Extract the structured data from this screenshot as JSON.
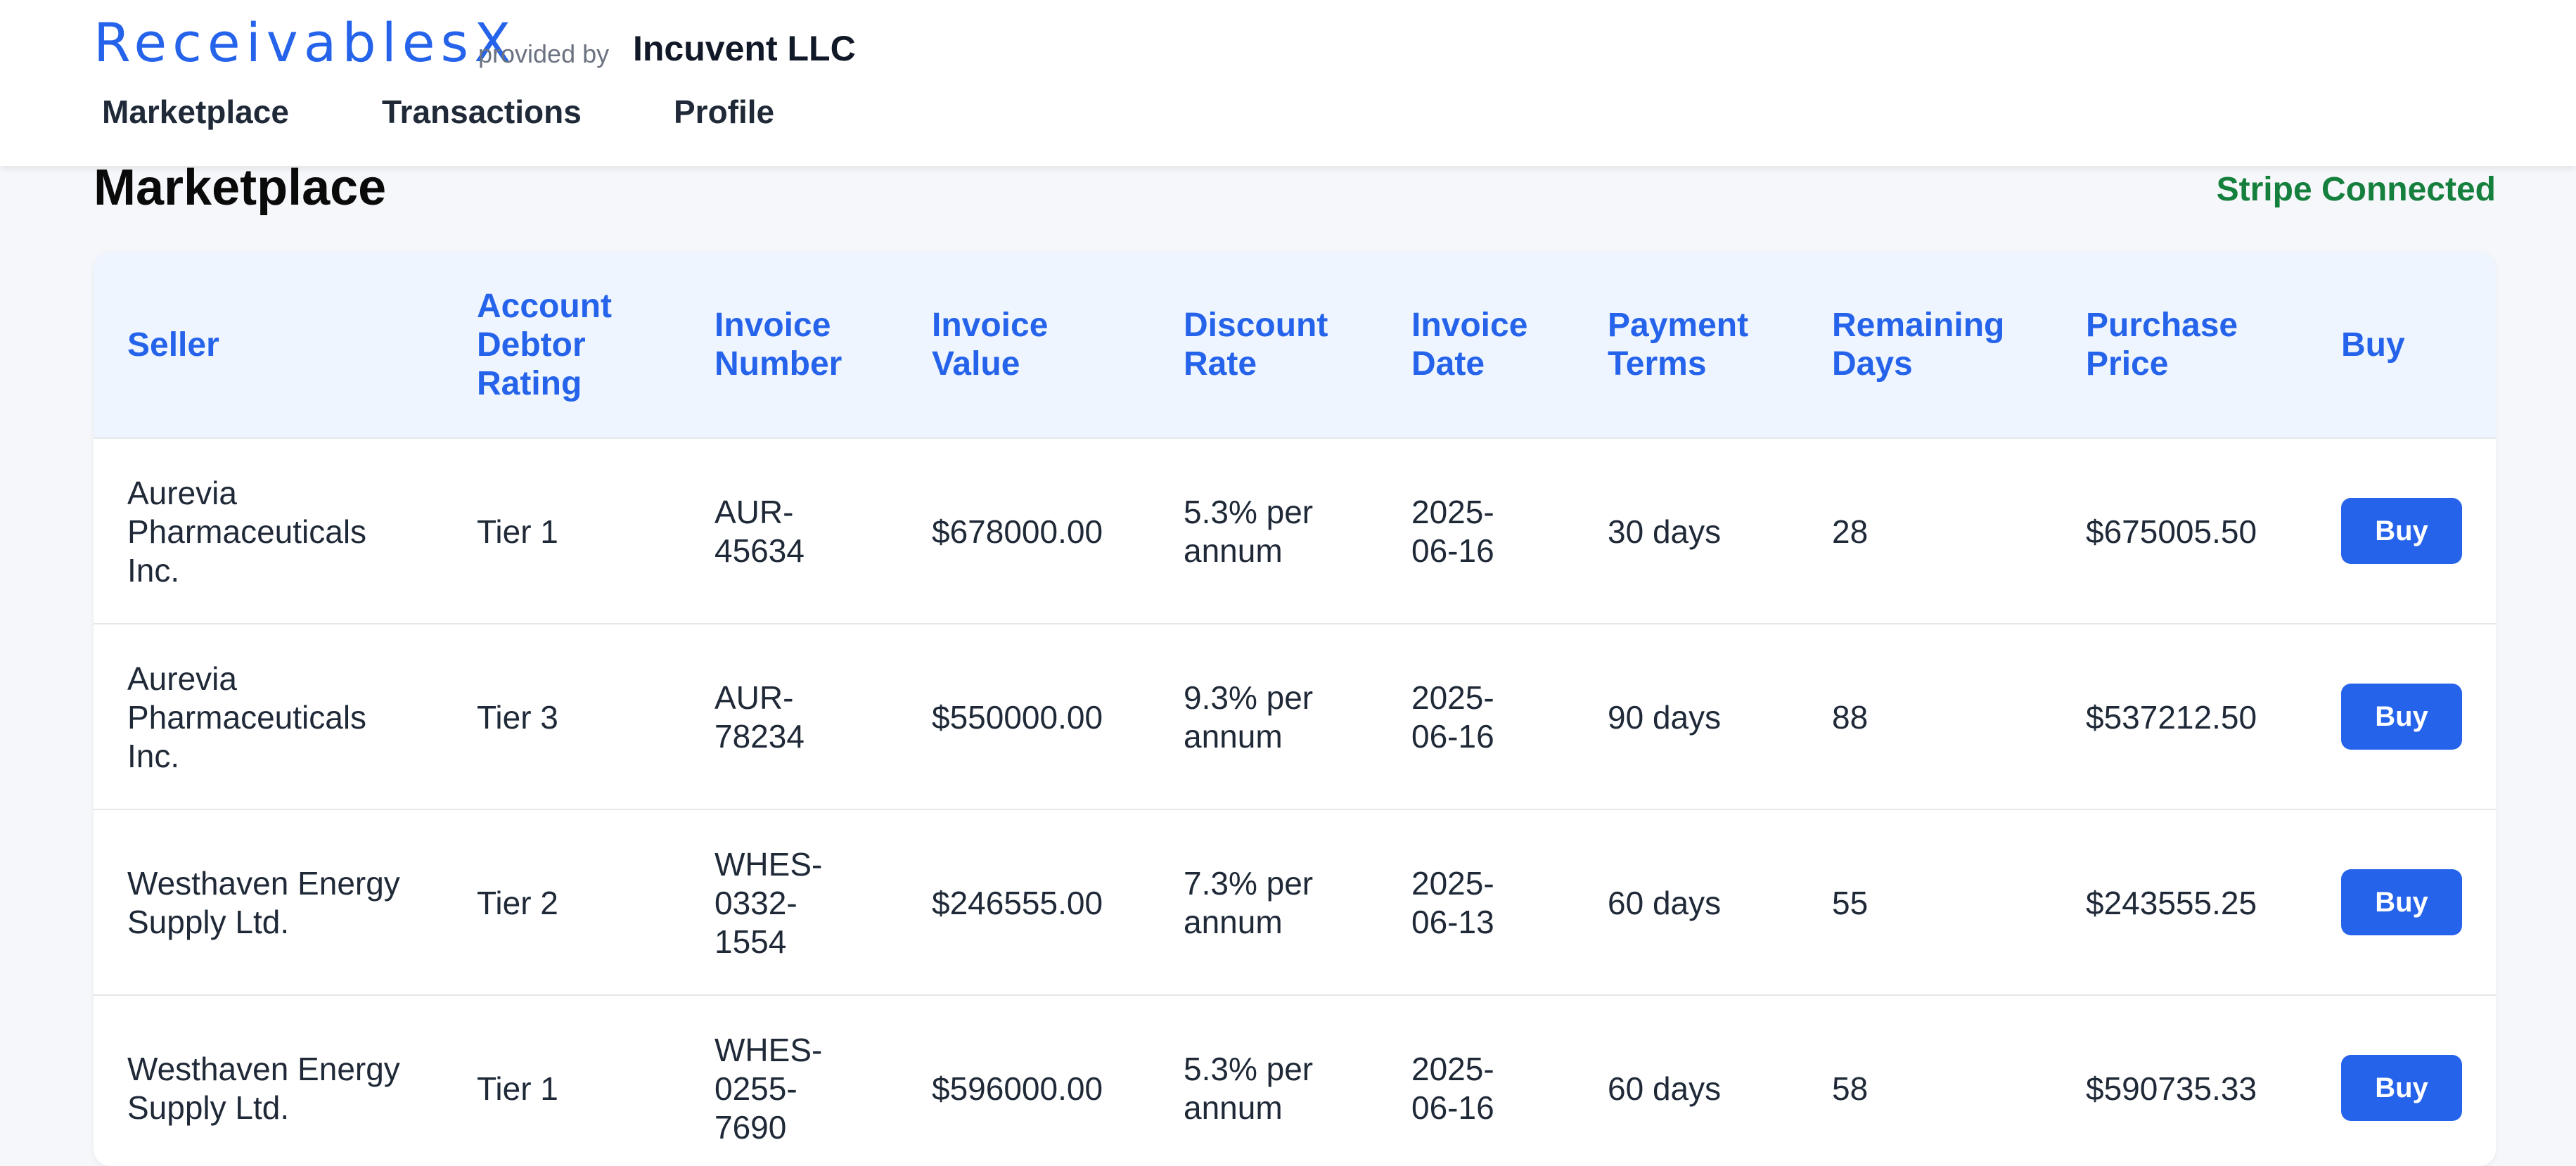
{
  "header": {
    "brand": "ReceivablesX",
    "provided_by": "provided by",
    "company": "Incuvent LLC",
    "nav": [
      "Marketplace",
      "Transactions",
      "Profile"
    ]
  },
  "page": {
    "title": "Marketplace",
    "stripe_status": "Stripe Connected"
  },
  "table": {
    "headers": [
      "Seller",
      "Account Debtor Rating",
      "Invoice Number",
      "Invoice Value",
      "Discount Rate",
      "Invoice Date",
      "Payment Terms",
      "Remaining Days",
      "Purchase Price",
      "Buy"
    ],
    "rows": [
      [
        "Aurevia Pharmaceuticals Inc.",
        "Tier 1",
        "AUR-45634",
        "$678000.00",
        "5.3% per annum",
        "2025-06-16",
        "30 days",
        "28",
        "$675005.50",
        "Buy"
      ],
      [
        "Aurevia Pharmaceuticals Inc.",
        "Tier 3",
        "AUR-78234",
        "$550000.00",
        "9.3% per annum",
        "2025-06-16",
        "90 days",
        "88",
        "$537212.50",
        "Buy"
      ],
      [
        "Westhaven Energy Supply Ltd.",
        "Tier 2",
        "WHES-0332-1554",
        "$246555.00",
        "7.3% per annum",
        "2025-06-13",
        "60 days",
        "55",
        "$243555.25",
        "Buy"
      ],
      [
        "Westhaven Energy Supply Ltd.",
        "Tier 1",
        "WHES-0255-7690",
        "$596000.00",
        "5.3% per annum",
        "2025-06-16",
        "60 days",
        "58",
        "$590735.33",
        "Buy"
      ]
    ]
  },
  "colors": {
    "brand": "#2563eb",
    "header_text": "#2563eb",
    "header_bg": "#eff5ff",
    "stripe_status": "#15803d",
    "button_bg": "#2563eb"
  }
}
